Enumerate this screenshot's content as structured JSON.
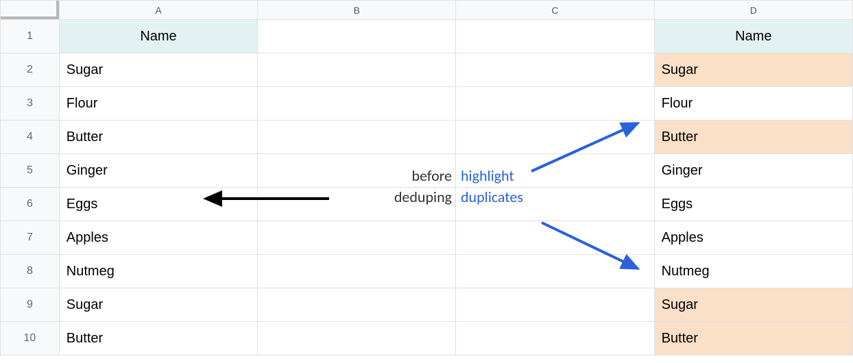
{
  "columns": [
    "A",
    "B",
    "C",
    "D"
  ],
  "rowNumbers": [
    "1",
    "2",
    "3",
    "4",
    "5",
    "6",
    "7",
    "8",
    "9",
    "10"
  ],
  "headerA": "Name",
  "headerD": "Name",
  "colA": [
    "Sugar",
    "Flour",
    "Butter",
    "Ginger",
    "Eggs",
    "Apples",
    "Nutmeg",
    "Sugar",
    "Butter"
  ],
  "colD": [
    "Sugar",
    "Flour",
    "Butter",
    "Ginger",
    "Eggs",
    "Apples",
    "Nutmeg",
    "Sugar",
    "Butter"
  ],
  "highlightsD": [
    true,
    false,
    true,
    false,
    false,
    false,
    false,
    true,
    true
  ],
  "annotation_left": {
    "line1": "before",
    "line2": "deduping"
  },
  "annotation_right": {
    "line1": "highlight",
    "line2": "duplicates"
  },
  "colors": {
    "arrow_black": "#000000",
    "arrow_blue": "#2962d9",
    "highlight_bg": "#f9e0c7",
    "header_bg": "#e2f2f2"
  }
}
